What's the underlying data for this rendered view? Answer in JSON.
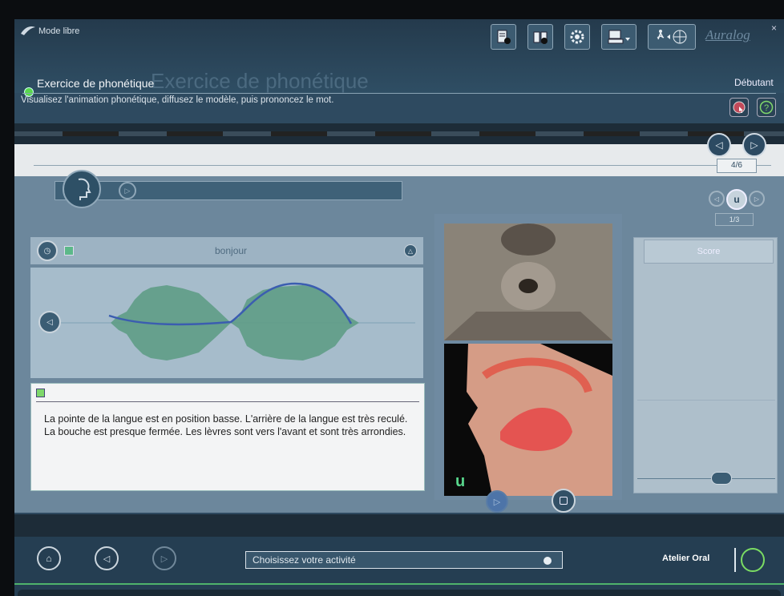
{
  "window": {
    "mode_label": "Mode libre",
    "brand": "Auralog",
    "close": "×"
  },
  "header": {
    "ghost_title": "Exercice de phonétique",
    "title": "Exercice de phonétique",
    "subtitle": "Visualisez l'animation phonétique, diffusez le modèle, puis prononcez le mot.",
    "level": "Débutant"
  },
  "nav": {
    "exercise_counter": "4/6",
    "phoneme_counter": "1/3",
    "phoneme": "u"
  },
  "exercise": {
    "word": "bonjour",
    "description": "La pointe de la langue est en position basse. L'arrière de la langue est très reculé. La bouche est presque fermée. Les lèvres sont vers l'avant et sont très arrondies.",
    "video_phoneme": "u",
    "score_label": "Score"
  },
  "bottom": {
    "activity_placeholder": "Choisissez votre activité",
    "workshop": "Atelier Oral"
  },
  "icons": {
    "toolbar": [
      "notepad-icon",
      "book-icon",
      "settings-icon",
      "computer-icon",
      "walk-globe-icon"
    ],
    "help": "help-icon",
    "record": "record-icon"
  },
  "colors": {
    "accent_green": "#58d64c",
    "panel": "#2e4a60",
    "waveform": "#5f9c86",
    "pitch": "#3b5db0"
  }
}
